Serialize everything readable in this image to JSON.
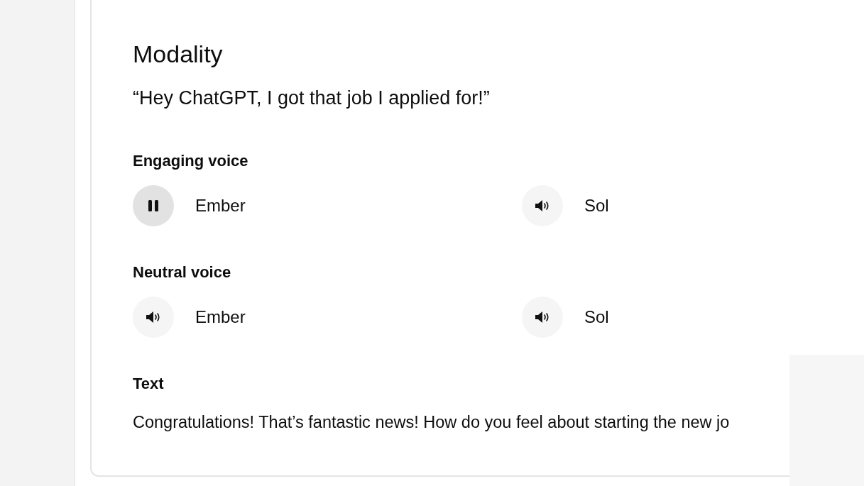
{
  "section": {
    "title": "Modality",
    "prompt": "“Hey ChatGPT, I got that job I applied for!”"
  },
  "voice_groups": [
    {
      "label": "Engaging voice",
      "voices": [
        {
          "name": "Ember",
          "playing": true
        },
        {
          "name": "Sol",
          "playing": false
        }
      ]
    },
    {
      "label": "Neutral voice",
      "voices": [
        {
          "name": "Ember",
          "playing": false
        },
        {
          "name": "Sol",
          "playing": false
        }
      ]
    }
  ],
  "text_output": {
    "label": "Text",
    "body": "Congratulations! That’s fantastic news! How do you feel about starting the new jo"
  }
}
